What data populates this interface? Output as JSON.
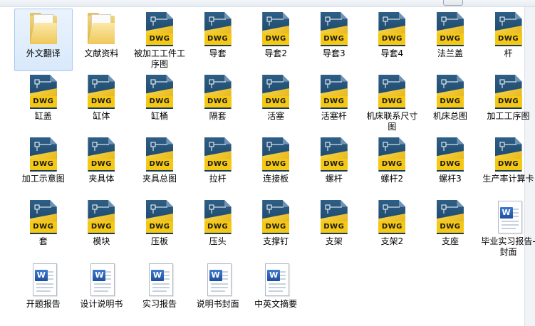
{
  "window": {
    "items": [
      {
        "label": "外文翻译",
        "type": "folder",
        "selected": true
      },
      {
        "label": "文献资料",
        "type": "folder"
      },
      {
        "label": "被加工工件工序图",
        "type": "dwg"
      },
      {
        "label": "导套",
        "type": "dwg"
      },
      {
        "label": "导套2",
        "type": "dwg"
      },
      {
        "label": "导套3",
        "type": "dwg"
      },
      {
        "label": "导套4",
        "type": "dwg"
      },
      {
        "label": "法兰盖",
        "type": "dwg"
      },
      {
        "label": "杆",
        "type": "dwg"
      },
      {
        "label": "缸盖",
        "type": "dwg"
      },
      {
        "label": "缸体",
        "type": "dwg"
      },
      {
        "label": "缸桶",
        "type": "dwg"
      },
      {
        "label": "隔套",
        "type": "dwg"
      },
      {
        "label": "活塞",
        "type": "dwg"
      },
      {
        "label": "活塞杆",
        "type": "dwg"
      },
      {
        "label": "机床联系尺寸图",
        "type": "dwg"
      },
      {
        "label": "机床总图",
        "type": "dwg"
      },
      {
        "label": "加工工序图",
        "type": "dwg"
      },
      {
        "label": "加工示意图",
        "type": "dwg"
      },
      {
        "label": "夹具体",
        "type": "dwg"
      },
      {
        "label": "夹具总图",
        "type": "dwg"
      },
      {
        "label": "拉杆",
        "type": "dwg"
      },
      {
        "label": "连接板",
        "type": "dwg"
      },
      {
        "label": "螺杆",
        "type": "dwg"
      },
      {
        "label": "螺杆2",
        "type": "dwg"
      },
      {
        "label": "螺杆3",
        "type": "dwg"
      },
      {
        "label": "生产率计算卡",
        "type": "dwg"
      },
      {
        "label": "套",
        "type": "dwg"
      },
      {
        "label": "模块",
        "type": "dwg"
      },
      {
        "label": "压板",
        "type": "dwg"
      },
      {
        "label": "压头",
        "type": "dwg"
      },
      {
        "label": "支撑钉",
        "type": "dwg"
      },
      {
        "label": "支架",
        "type": "dwg"
      },
      {
        "label": "支架2",
        "type": "dwg"
      },
      {
        "label": "支座",
        "type": "dwg"
      },
      {
        "label": "毕业实习报告-封面",
        "type": "doc"
      },
      {
        "label": "开题报告",
        "type": "doc"
      },
      {
        "label": "设计说明书",
        "type": "doc"
      },
      {
        "label": "实习报告",
        "type": "doc"
      },
      {
        "label": "说明书封面",
        "type": "doc"
      },
      {
        "label": "中英文摘要",
        "type": "doc"
      }
    ],
    "icon_names": {
      "folder": "folder-icon",
      "dwg": "dwg-file-icon",
      "doc": "word-document-icon"
    },
    "dwg_badge_text": "DWG",
    "doc_badge_text": "W",
    "colors": {
      "selection_bg": "#d9e9fb",
      "dwg_blue": "#1f4a6e",
      "dwg_yellow": "#f5c816"
    }
  }
}
